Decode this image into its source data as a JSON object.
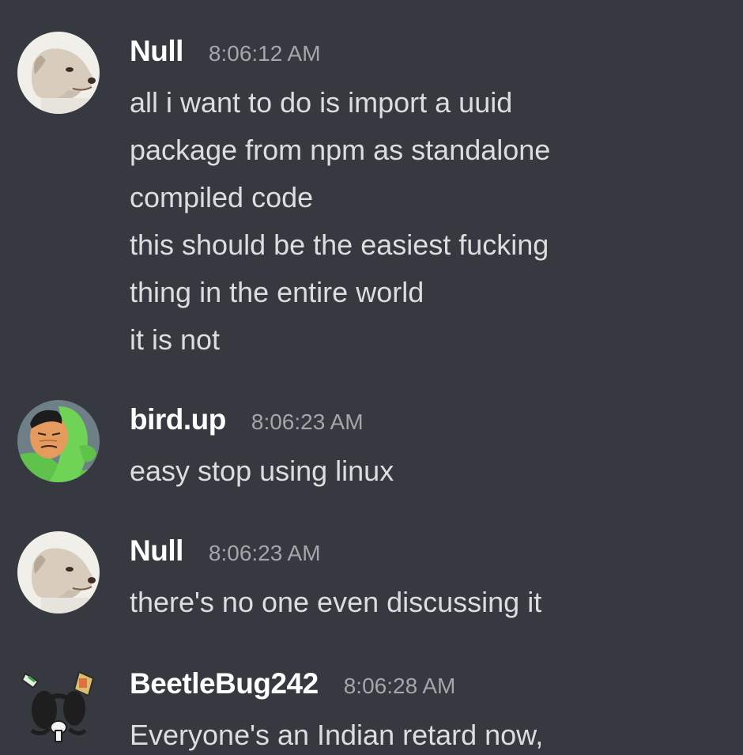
{
  "messages": [
    {
      "author": "Null",
      "avatar_icon": "dog-avatar-icon",
      "timestamp": "8:06:12 AM",
      "lines": [
        "all i want to do is import a uuid",
        "package from npm as standalone",
        "compiled code",
        "this should be the easiest fucking",
        "thing in the entire world",
        "it is not"
      ]
    },
    {
      "author": "bird.up",
      "avatar_icon": "hooded-face-avatar-icon",
      "timestamp": "8:06:23 AM",
      "lines": [
        "easy stop using linux"
      ]
    },
    {
      "author": "Null",
      "avatar_icon": "dog-avatar-icon",
      "timestamp": "8:06:23 AM",
      "lines": [
        "there's no one even discussing it"
      ]
    },
    {
      "author": "BeetleBug242",
      "avatar_icon": "cartoon-beetle-avatar-icon",
      "timestamp": "8:06:28 AM",
      "lines": [
        "Everyone's an Indian retard now,"
      ]
    }
  ],
  "colors": {
    "background": "#36393f",
    "username": "#ffffff",
    "message_text": "#dcddde",
    "timestamp": "#a3a6aa"
  }
}
